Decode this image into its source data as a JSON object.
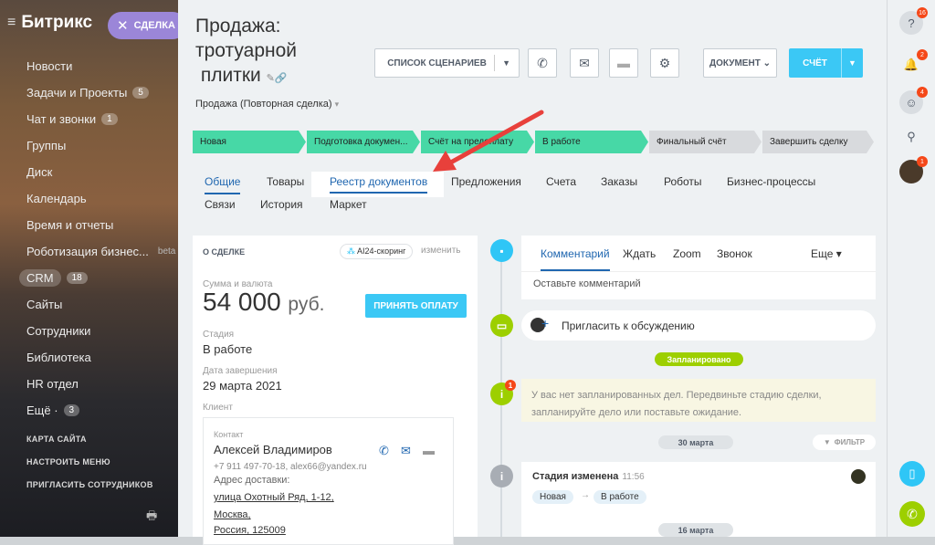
{
  "sidebar": {
    "logo": "Битрикс",
    "deal_pill": "СДЕЛКА",
    "items": [
      {
        "label": "Новости"
      },
      {
        "label": "Задачи и Проекты",
        "badge": "5"
      },
      {
        "label": "Чат и звонки",
        "badge": "1"
      },
      {
        "label": "Группы"
      },
      {
        "label": "Диск"
      },
      {
        "label": "Календарь"
      },
      {
        "label": "Время и отчеты"
      },
      {
        "label": "Роботизация бизнес...",
        "tag": "beta"
      },
      {
        "label": "CRM",
        "badge": "18"
      },
      {
        "label": "Сайты"
      },
      {
        "label": "Сотрудники"
      },
      {
        "label": "Библиотека"
      },
      {
        "label": "HR отдел"
      },
      {
        "label": "Ещё ·",
        "badge": "3"
      }
    ],
    "bottom": [
      "КАРТА САЙТА",
      "НАСТРОИТЬ МЕНЮ",
      "ПРИГЛАСИТЬ СОТРУДНИКОВ"
    ]
  },
  "header": {
    "title_line1": "Продажа:",
    "title_line2": "тротуарной",
    "title_line3": "плитки",
    "subtitle": "Продажа (Повторная сделка)",
    "scenarios_label": "СПИСОК СЦЕНАРИЕВ",
    "document_label": "ДОКУМЕНТ",
    "invoice_label": "СЧЁТ"
  },
  "stages": [
    {
      "label": "Новая",
      "done": true
    },
    {
      "label": "Подготовка докумен...",
      "done": true
    },
    {
      "label": "Счёт на предоплату",
      "done": true
    },
    {
      "label": "В работе",
      "done": true
    },
    {
      "label": "Финальный счёт",
      "done": false
    },
    {
      "label": "Завершить сделку",
      "done": false
    }
  ],
  "tabs": {
    "row1": [
      "Общие",
      "Товары",
      "Реестр документов",
      "Предложения",
      "Счета",
      "Заказы",
      "Роботы",
      "Бизнес-процессы"
    ],
    "row2": [
      "Связи",
      "История",
      "Маркет"
    ]
  },
  "card": {
    "header": "О СДЕЛКЕ",
    "ai_tag": "AI24-скоринг",
    "edit": "изменить",
    "sum_label": "Сумма и валюта",
    "sum_value": "54 000",
    "sum_currency": "руб.",
    "pay_button": "ПРИНЯТЬ ОПЛАТУ",
    "stage_label": "Стадия",
    "stage_value": "В работе",
    "date_label": "Дата завершения",
    "date_value": "29 марта 2021",
    "client_label": "Клиент",
    "contact": {
      "label": "Контакт",
      "name": "Алексей Владимиров",
      "phone_email": "+7 911 497-70-18, alex66@yandex.ru",
      "address_label": "Адрес доставки:",
      "address_lines": [
        "улица Охотный Ряд, 1-12,",
        "Москва,",
        "Россия, 125009"
      ]
    }
  },
  "timeline": {
    "editor_tabs": [
      "Комментарий",
      "Ждать",
      "Zoom",
      "Звонок",
      "Еще"
    ],
    "editor_placeholder": "Оставьте комментарий",
    "invite": "Пригласить к обсуждению",
    "planned": "Запланировано",
    "notice_line1": "У вас нет запланированных дел. Передвиньте стадию сделки,",
    "notice_line2": "запланируйте дело или поставьте ожидание.",
    "date1": "30 марта",
    "filter": "ФИЛЬТР",
    "change_title": "Стадия изменена",
    "change_time": "11:56",
    "change_from": "Новая",
    "change_to": "В работе",
    "date2": "16 марта",
    "notice_badge": "1"
  },
  "right_panel": {
    "help_badge": "16",
    "bell_badge": "2",
    "chat_badge": "4",
    "avatar_badge": "1"
  },
  "colors": {
    "accent": "#3bc8f5",
    "stage_done": "#47d8a6",
    "link": "#2067b0",
    "green": "#9dcf00",
    "annotation_arrow": "#e8403b"
  }
}
